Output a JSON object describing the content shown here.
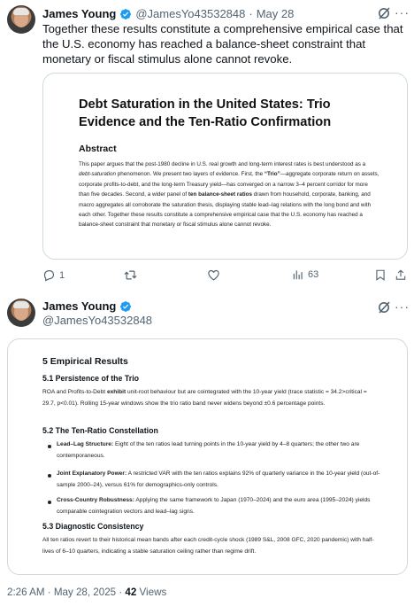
{
  "tweet1": {
    "name": "James Young",
    "handle": "@JamesYo43532848",
    "dot": "·",
    "date": "May 28",
    "text": "Together these results constitute a comprehensive empirical case that the U.S. economy has reached a balance-sheet constraint that monetary or fiscal stimulus alone cannot revoke.",
    "paper": {
      "title": "Debt Saturation in the United States: Trio Evidence and the Ten-Ratio Confirmation",
      "abstract_heading": "Abstract",
      "abstract_part1": "This paper argues that the post-1980 decline in U.S. real growth and long-term interest rates is best understood as a ",
      "abstract_italic1": "debt-saturation",
      "abstract_part2": " phenomenon. We present two layers of evidence. First, the ",
      "abstract_bold1": "“Trio”",
      "abstract_part3": "—aggregate corporate return on assets, corporate profits-to-debt, and the long-term Treasury yield—has converged on a narrow 3–4 percent corridor for more than five decades. Second, a wider panel of ",
      "abstract_bold2": "ten balance-sheet ratios",
      "abstract_part4": " drawn from household, corporate, banking, and macro aggregates all corroborate the saturation thesis, displaying stable lead–lag relations with the long bond and with each other. Together these results constitute a comprehensive empirical case that the U.S. economy has reached a balance-sheet constraint that monetary or fiscal stimulus alone cannot revoke."
    },
    "actions": {
      "replies": "1",
      "reposts": "",
      "likes": "",
      "views": "63"
    }
  },
  "tweet2": {
    "name": "James Young",
    "handle": "@JamesYo43532848",
    "results": {
      "h1": "5    Empirical Results",
      "h51": "5.1    Persistence of the Trio",
      "p51_a": "ROA and Profits-to-Debt ",
      "p51_b": "exhibit",
      "p51_c": " unit-root behaviour but are cointegrated with the 10-year yield (trace statistic = 34.2>critical = 29.7, p<0.01). Rolling 15-year windows show the trio ratio band never widens beyond ±0.6 percentage points.",
      "h52": "5.2    The Ten-Ratio Constellation",
      "b1_label": "Lead–Lag Structure:",
      "b1_text": " Eight of the ten ratios lead turning points in the 10-year yield by 4–8 quarters; the other two are contemporaneous.",
      "b2_label": "Joint Explanatory Power:",
      "b2_text": " A restricted VAR with the ten ratios explains 92% of quarterly variance in the 10-year yield (out-of-sample 2000–24), versus 61% for demographics-only controls.",
      "b3_label": "Cross-Country Robustness:",
      "b3_text": " Applying the same framework to Japan (1970–2024) and the euro area (1995–2024) yields comparable cointegration vectors and lead–lag signs.",
      "h53": "5.3    Diagnostic Consistency",
      "p53": "All ten ratios revert to their historical mean bands after each credit-cycle shock (1989 S&L, 2008 GFC, 2020 pandemic) with half-lives of 6–10 quarters, indicating a stable saturation ceiling rather than regime drift."
    },
    "footer": {
      "time": "2:26 AM · May 28, 2025 · ",
      "views_count": "42",
      "views_label": " Views"
    }
  },
  "colors": {
    "accent": "#1d9bf0",
    "secondary_text": "#536471",
    "border": "#cfd9de"
  }
}
